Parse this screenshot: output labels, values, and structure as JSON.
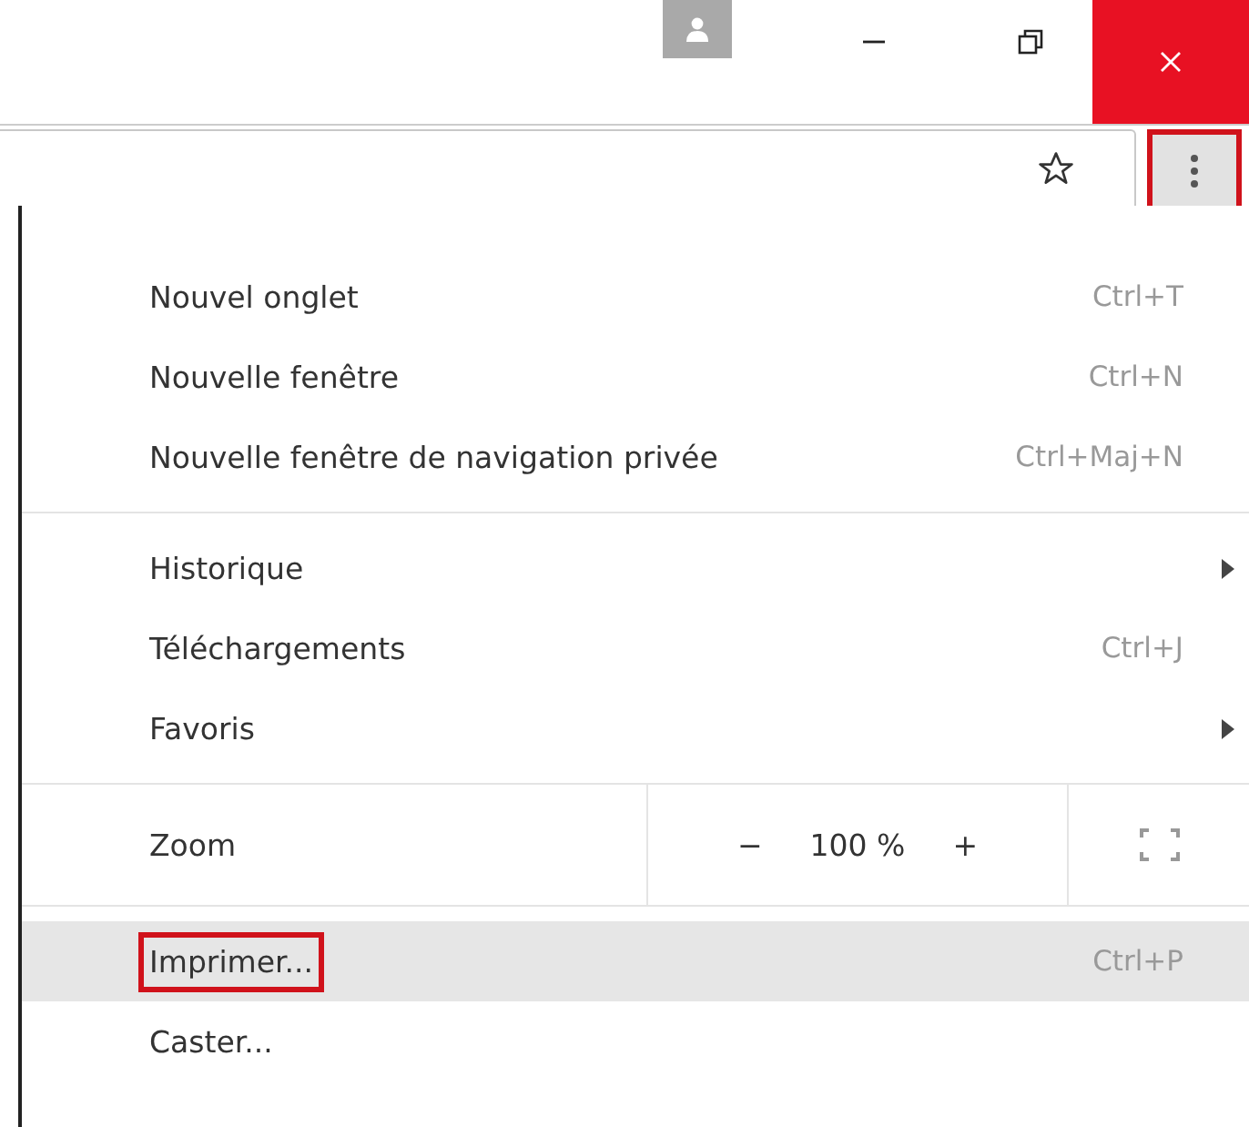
{
  "toolbar": {
    "menu_button": {
      "annotated": true
    }
  },
  "menu": {
    "groups": [
      {
        "items": [
          {
            "kind": "item",
            "label": "Nouvel onglet",
            "shortcut": "Ctrl+T",
            "selected": false,
            "annotated": false
          },
          {
            "kind": "item",
            "label": "Nouvelle fenêtre",
            "shortcut": "Ctrl+N",
            "selected": false,
            "annotated": false
          },
          {
            "kind": "item",
            "label": "Nouvelle fenêtre de navigation privée",
            "shortcut": "Ctrl+Maj+N",
            "selected": false,
            "annotated": false
          }
        ]
      },
      {
        "items": [
          {
            "kind": "submenu",
            "label": "Historique",
            "selected": false,
            "annotated": false
          },
          {
            "kind": "item",
            "label": "Téléchargements",
            "shortcut": "Ctrl+J",
            "selected": false,
            "annotated": false
          },
          {
            "kind": "submenu",
            "label": "Favoris",
            "selected": false,
            "annotated": false
          }
        ]
      },
      {
        "items": [
          {
            "kind": "zoom",
            "label": "Zoom",
            "minus": "−",
            "value": "100 %",
            "plus": "+"
          }
        ]
      },
      {
        "items": [
          {
            "kind": "item",
            "label": "Imprimer...",
            "shortcut": "Ctrl+P",
            "selected": true,
            "annotated": true
          },
          {
            "kind": "item",
            "label": "Caster...",
            "selected": false,
            "annotated": false
          }
        ]
      }
    ]
  }
}
